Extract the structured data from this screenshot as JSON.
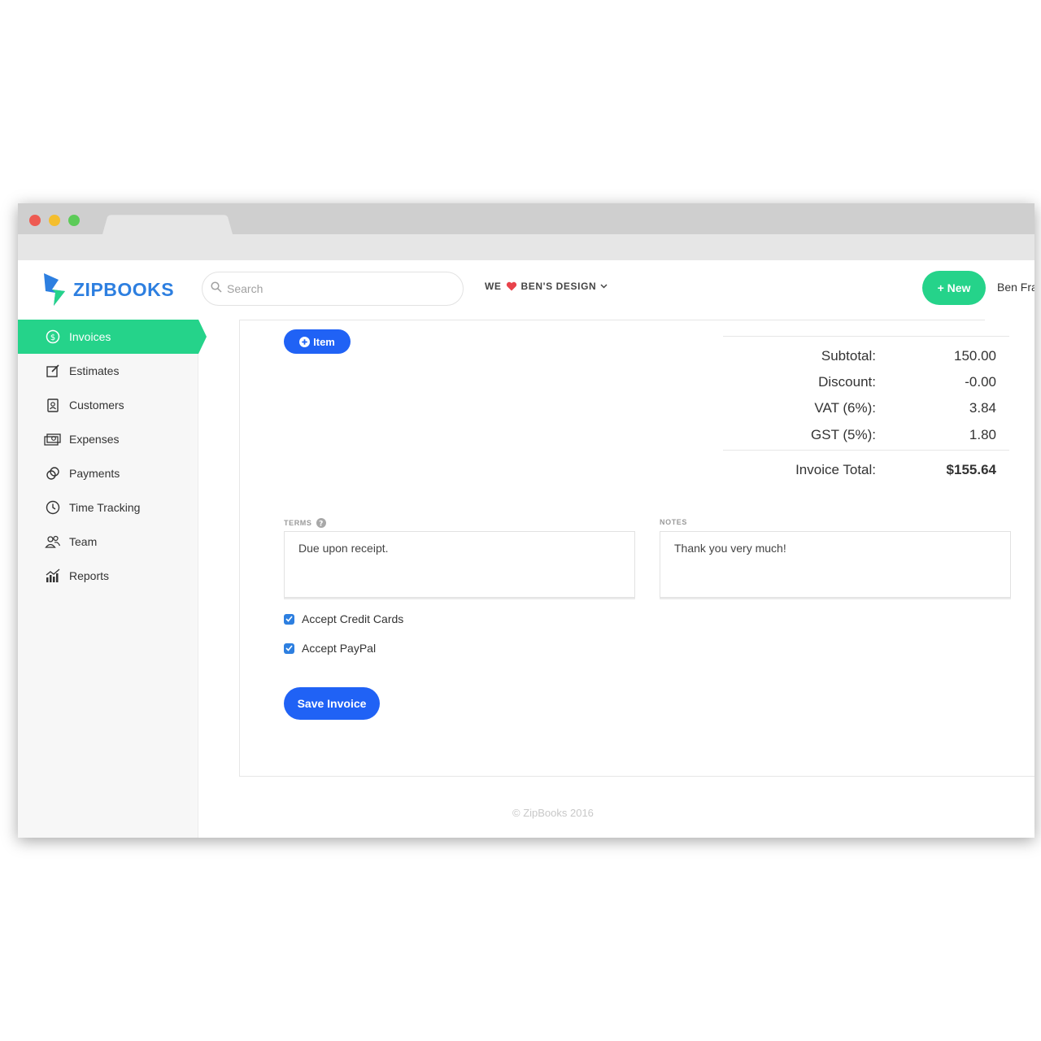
{
  "brand": {
    "name": "ZIPBOOKS"
  },
  "search": {
    "placeholder": "Search"
  },
  "company": {
    "prefix": "WE",
    "name": "BEN'S DESIGN"
  },
  "header": {
    "new_label": "+ New",
    "user_name": "Ben Fra"
  },
  "sidebar": {
    "items": [
      {
        "label": "Invoices",
        "icon": "dollar-circle-icon",
        "active": true
      },
      {
        "label": "Estimates",
        "icon": "edit-icon"
      },
      {
        "label": "Customers",
        "icon": "contact-book-icon"
      },
      {
        "label": "Expenses",
        "icon": "money-stack-icon"
      },
      {
        "label": "Payments",
        "icon": "coins-icon"
      },
      {
        "label": "Time Tracking",
        "icon": "clock-icon"
      },
      {
        "label": "Team",
        "icon": "team-icon"
      },
      {
        "label": "Reports",
        "icon": "bar-chart-icon"
      }
    ]
  },
  "invoice": {
    "add_item_label": "Item",
    "totals": [
      {
        "label": "Subtotal:",
        "value": "150.00"
      },
      {
        "label": "Discount:",
        "value": "-0.00"
      },
      {
        "label": "VAT (6%):",
        "value": "3.84"
      },
      {
        "label": "GST (5%):",
        "value": "1.80"
      }
    ],
    "total": {
      "label": "Invoice Total:",
      "value": "$155.64"
    },
    "terms": {
      "label": "TERMS",
      "value": "Due upon receipt."
    },
    "notes": {
      "label": "NOTES",
      "value": "Thank you very much!"
    },
    "accept_credit_cards": {
      "label": "Accept Credit Cards",
      "checked": true
    },
    "accept_paypal": {
      "label": "Accept PayPal",
      "checked": true
    },
    "save_label": "Save Invoice"
  },
  "footer": {
    "text": "© ZipBooks 2016"
  },
  "colors": {
    "accent_green": "#25d38a",
    "primary_blue": "#2062f5",
    "brand_blue": "#2d7fe0",
    "heart_red": "#e8434b"
  }
}
